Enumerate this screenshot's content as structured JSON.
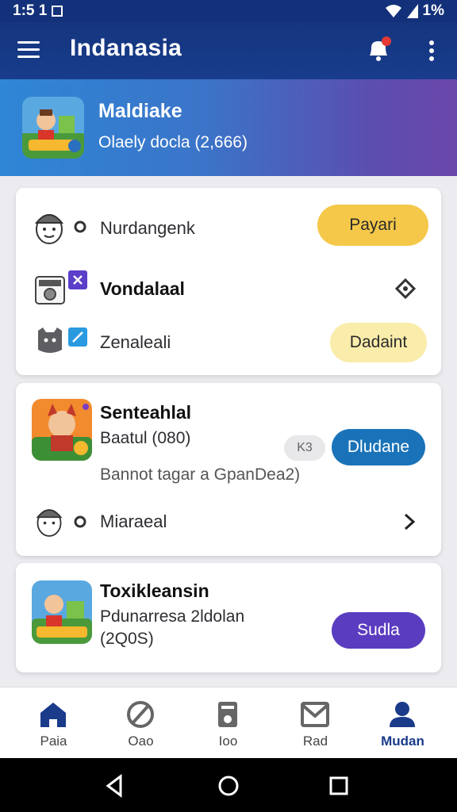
{
  "status_bar": {
    "time": "1:5 1",
    "battery": "1%"
  },
  "app_bar": {
    "title": "Indanasia",
    "notification_badge": ""
  },
  "banner": {
    "title": "Maldiake",
    "subtitle": "Olaely docla (2,666)"
  },
  "card1": {
    "row1": {
      "label": "Nurdangenk",
      "button": "Payari"
    },
    "row2": {
      "label": "Vondalaal"
    },
    "row3": {
      "label": "Zenaleali",
      "button": "Dadaint"
    }
  },
  "card2": {
    "title": "Senteahlal",
    "subtitle": "Baatul (080)",
    "chip": "K3",
    "button": "Dludane",
    "desc": "Bannot tagar a GpanDea2)",
    "row_label": "Miaraeal"
  },
  "card3": {
    "title": "Toxikleansin",
    "line1": "Pdunarresa 2ldolan",
    "line2": "(2Q0S)",
    "button": "Sudla"
  },
  "bottom_nav": [
    {
      "label": "Paia"
    },
    {
      "label": "Oao"
    },
    {
      "label": "Ioo"
    },
    {
      "label": "Rad"
    },
    {
      "label": "Mudan"
    }
  ],
  "colors": {
    "primary": "#15357e",
    "yellow_button": "#f5c84a",
    "light_yellow_button": "#faecaa",
    "blue_button": "#1a73b8",
    "purple_button": "#5a3cc0"
  }
}
